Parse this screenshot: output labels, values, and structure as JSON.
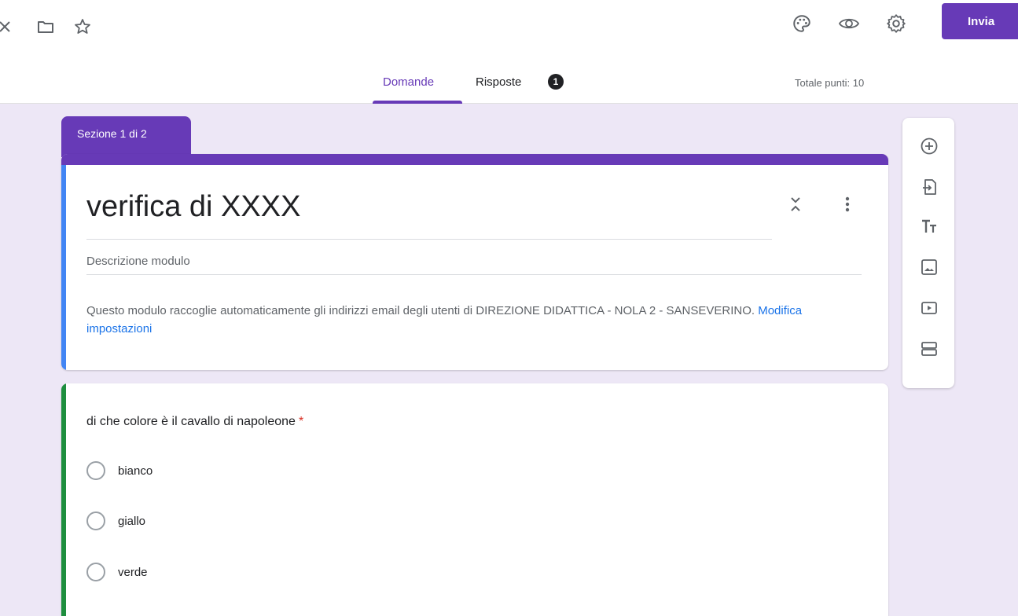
{
  "header": {
    "send_label": "Invia"
  },
  "tabs": {
    "questions": "Domande",
    "responses": "Risposte",
    "responses_count": "1",
    "total_points": "Totale punti: 10"
  },
  "section": {
    "label": "Sezione 1 di 2"
  },
  "form": {
    "title": "verifica di XXXX",
    "description_placeholder": "Descrizione modulo",
    "notice_text": "Questo modulo raccoglie automaticamente gli indirizzi email degli utenti di DIREZIONE DIDATTICA - NOLA 2 - SANSEVERINO.",
    "notice_link": "Modifica impostazioni"
  },
  "question": {
    "text": "di che colore è il cavallo di napoleone",
    "required_mark": "*",
    "options": [
      "bianco",
      "giallo",
      "verde"
    ]
  },
  "colors": {
    "accent": "#673ab7",
    "title_strip": "#4285f4",
    "question_strip": "#1e8e3e",
    "link": "#1a73e8",
    "required": "#d93025",
    "background": "#ede7f6"
  }
}
